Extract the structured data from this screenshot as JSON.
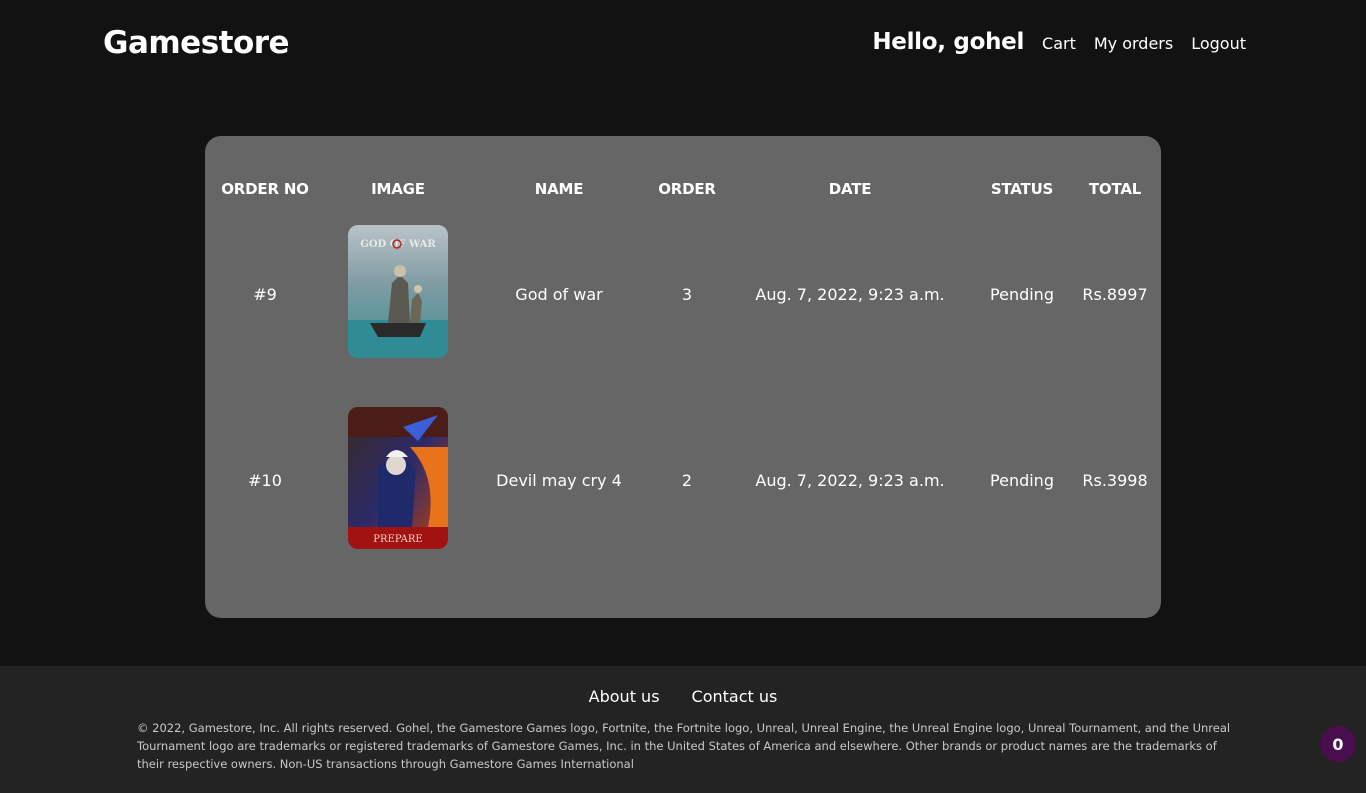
{
  "header": {
    "brand": "Gamestore",
    "greeting": "Hello, gohel",
    "nav": {
      "cart": "Cart",
      "orders": "My orders",
      "logout": "Logout"
    }
  },
  "orders_table": {
    "columns": [
      "ORDER NO",
      "IMAGE",
      "NAME",
      "ORDER",
      "DATE",
      "STATUS",
      "TOTAL"
    ],
    "rows": [
      {
        "order_no": "#9",
        "cover_title": "GOD OF WAR",
        "name": "God of war",
        "order": "3",
        "date": "Aug. 7, 2022, 9:23 a.m.",
        "status": "Pending",
        "total": "Rs.8997"
      },
      {
        "order_no": "#10",
        "cover_title": "PREPARE",
        "name": "Devil may cry 4",
        "order": "2",
        "date": "Aug. 7, 2022, 9:23 a.m.",
        "status": "Pending",
        "total": "Rs.3998"
      }
    ]
  },
  "footer": {
    "about": "About us",
    "contact": "Contact us",
    "legal": "© 2022, Gamestore, Inc. All rights reserved. Gohel, the Gamestore Games logo, Fortnite, the Fortnite logo, Unreal, Unreal Engine, the Unreal Engine logo, Unreal Tournament, and the Unreal Tournament logo are trademarks or registered trademarks of Gamestore Games, Inc. in the United States of America and elsewhere. Other brands or product names are the trademarks of their respective owners. Non-US transactions through Gamestore Games International"
  },
  "cart_badge": {
    "count": "0"
  },
  "colors": {
    "background": "#121212",
    "panel": "#666666",
    "footer": "#232323",
    "badge": "#4a0e4e"
  }
}
